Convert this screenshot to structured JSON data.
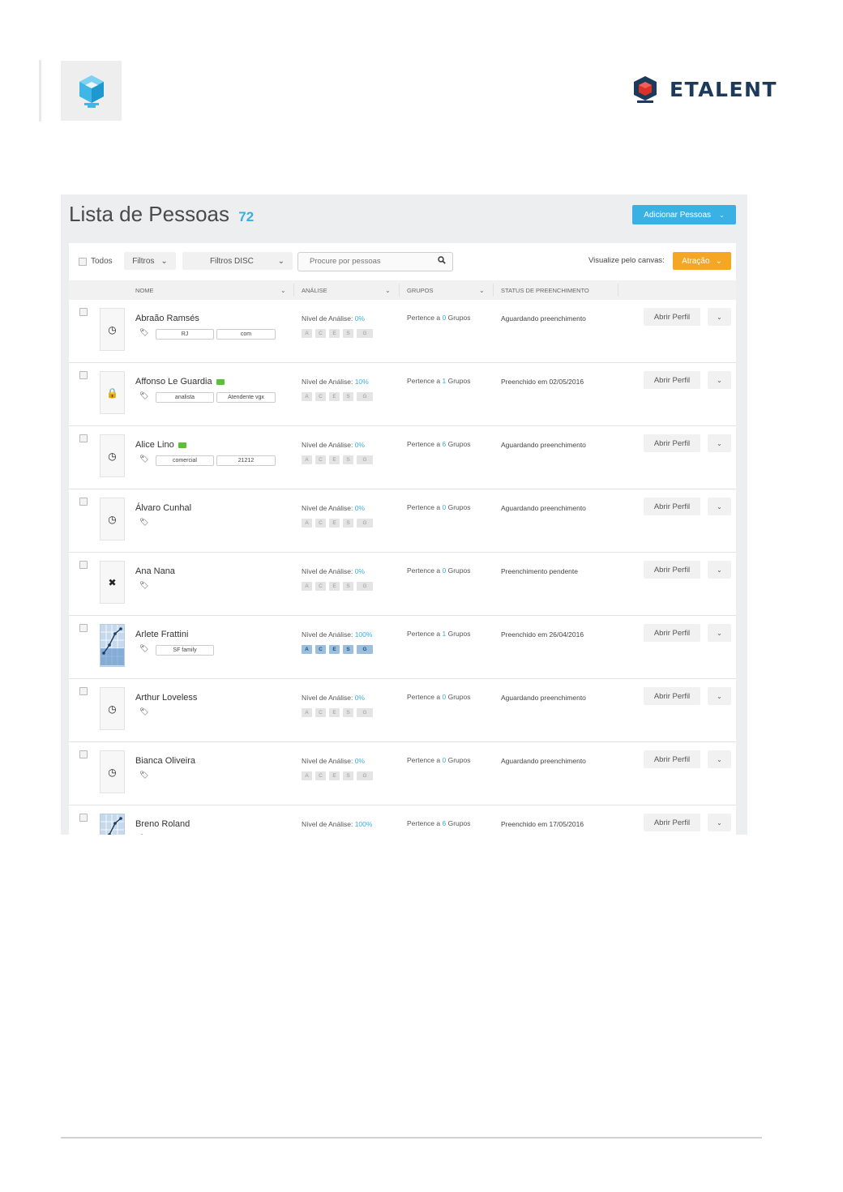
{
  "header": {
    "brand_name": "ETALENT"
  },
  "app": {
    "title": "Lista de Pessoas",
    "count": "72",
    "add_button": "Adicionar Pessoas",
    "toolbar": {
      "select_all_label": "Todos",
      "filters_label": "Filtros",
      "disc_filters_label": "Filtros DISC",
      "search_placeholder": "Procure por pessoas",
      "canvas_label": "Visualize pelo canvas:",
      "canvas_value": "Atração"
    },
    "columns": {
      "nome": "NOME",
      "analise": "ANÁLISE",
      "grupos": "GRUPOS",
      "status": "STATUS DE PREENCHIMENTO"
    },
    "disc_letters": [
      "A",
      "C",
      "E",
      "S",
      "G"
    ],
    "analysis_prefix": "Nível de Análise:",
    "group_prefix": "Pertence a",
    "group_suffix": "Grupos",
    "open_profile_label": "Abrir Perfil",
    "accent_color": "#39b2e3",
    "attraction_color": "#f5a623",
    "people": [
      {
        "name": "Abraão Ramsés",
        "icon": "clock-icon",
        "tags": [
          "RJ",
          "com"
        ],
        "analysis": "0%",
        "groups": "0",
        "status": "Aguardando preenchimento",
        "battery": false,
        "disc_active": false
      },
      {
        "name": "Affonso Le Guardia",
        "icon": "lock-icon",
        "tags": [
          "analista",
          "Atendente vgx"
        ],
        "analysis": "10%",
        "groups": "1",
        "status": "Preenchido em 02/05/2016",
        "battery": true,
        "disc_active": false
      },
      {
        "name": "Alice Lino",
        "icon": "clock-icon",
        "tags": [
          "comercial",
          "21212"
        ],
        "analysis": "0%",
        "groups": "6",
        "status": "Aguardando preenchimento",
        "battery": true,
        "disc_active": false
      },
      {
        "name": "Álvaro Cunhal",
        "icon": "clock-icon",
        "tags": [],
        "analysis": "0%",
        "groups": "0",
        "status": "Aguardando preenchimento",
        "battery": false,
        "disc_active": false
      },
      {
        "name": "Ana Nana",
        "icon": "close-icon",
        "tags": [],
        "analysis": "0%",
        "groups": "0",
        "status": "Preenchimento pendente",
        "battery": false,
        "disc_active": false
      },
      {
        "name": "Arlete Frattini",
        "icon": "disc-chart-icon",
        "tags": [
          "SF family"
        ],
        "analysis": "100%",
        "groups": "1",
        "status": "Preenchido em 26/04/2016",
        "battery": false,
        "disc_active": true
      },
      {
        "name": "Arthur Loveless",
        "icon": "clock-icon",
        "tags": [],
        "analysis": "0%",
        "groups": "0",
        "status": "Aguardando preenchimento",
        "battery": false,
        "disc_active": false
      },
      {
        "name": "Bianca Oliveira",
        "icon": "clock-icon",
        "tags": [],
        "analysis": "0%",
        "groups": "0",
        "status": "Aguardando preenchimento",
        "battery": false,
        "disc_active": false
      },
      {
        "name": "Breno Roland",
        "icon": "disc-chart-icon",
        "tags": [],
        "analysis": "100%",
        "groups": "6",
        "status": "Preenchido em 17/05/2016",
        "battery": false,
        "disc_active": true
      }
    ]
  }
}
